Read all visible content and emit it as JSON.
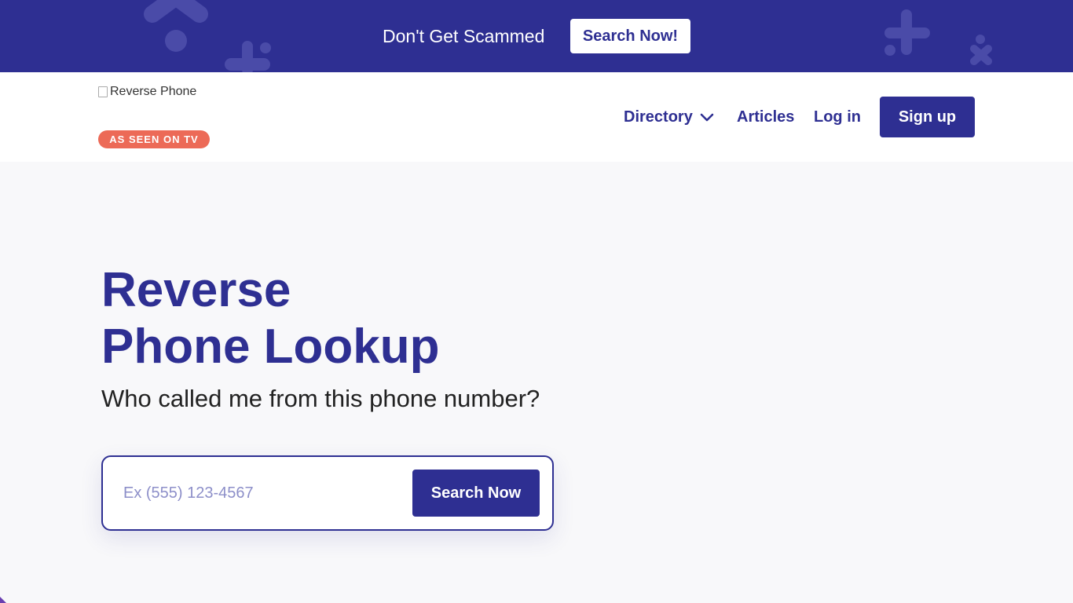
{
  "banner": {
    "text": "Don't Get Scammed",
    "button_label": "Search Now!",
    "background_color": "#2e2f92"
  },
  "header": {
    "logo_alt": "Reverse Phone",
    "badge": "AS SEEN ON TV",
    "badge_color": "#ec6a57",
    "nav": {
      "directory": "Directory",
      "articles": "Articles",
      "login": "Log in"
    },
    "signup_label": "Sign up"
  },
  "hero": {
    "title_line1": "Reverse",
    "title_line2": "Phone Lookup",
    "subtitle": "Who called me from this phone number?"
  },
  "search": {
    "placeholder": "Ex (555) 123-4567",
    "value": "",
    "button_label": "Search Now"
  },
  "icons": [
    "plus-shape-icon",
    "dot-icon",
    "cross-shape-icon",
    "chevron-down-icon",
    "broken-image-icon"
  ],
  "colors": {
    "accent": "#2e2f92",
    "page_background": "#f8f8fa"
  }
}
